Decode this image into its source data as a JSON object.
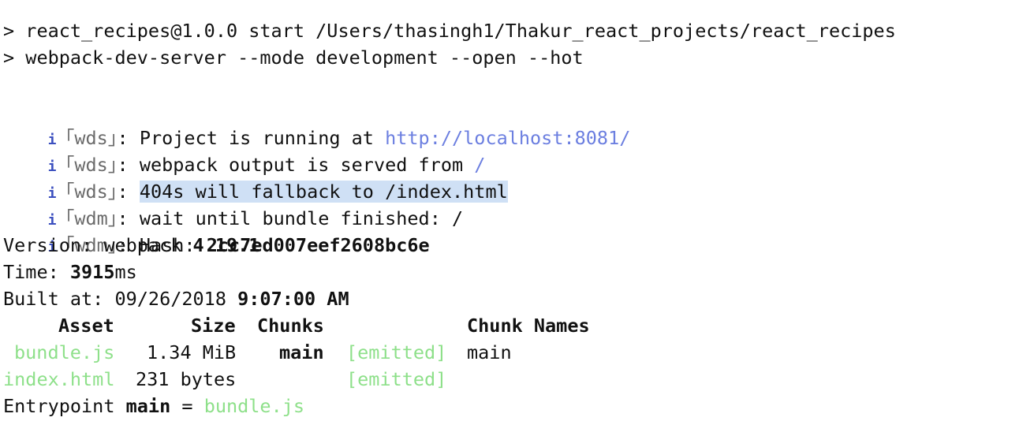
{
  "colors": {
    "background": "#ffffff",
    "text": "#111111",
    "info_icon": "#3b4fbf",
    "link": "#6c7fe0",
    "emitted_green": "#8ee08a",
    "selection": "#cfe0f5"
  },
  "header": {
    "line1": "> react_recipes@1.0.0 start /Users/thasingh1/Thakur_react_projects/react_recipes",
    "line2": "> webpack-dev-server --mode development --open --hot"
  },
  "info_icon_char": "i",
  "logs": [
    {
      "tag": "｢wds｣",
      "prefix": ": Project is running at ",
      "value": "http://localhost:8081/"
    },
    {
      "tag": "｢wds｣",
      "prefix": ": webpack output is served from ",
      "value": "/"
    },
    {
      "tag": "｢wds｣",
      "prefix": ": ",
      "value": "404s will fallback to /index.html"
    },
    {
      "tag": "｢wdm｣",
      "prefix": ": wait until bundle finished: /"
    },
    {
      "tag": "｢wdm｣",
      "prefix": ": Hash: ",
      "value": "2cc7ed007eef2608bc6e"
    }
  ],
  "version": {
    "label": "Version: webpack ",
    "value": "4.19.1"
  },
  "time": {
    "label": "Time: ",
    "value": "3915",
    "unit": "ms"
  },
  "built": {
    "label": "Built at: 09/26/2018 ",
    "value": "9:07:00 AM"
  },
  "table": {
    "headers": {
      "asset": "Asset",
      "size": "Size",
      "chunks": "Chunks",
      "chunk_names": "Chunk Names"
    },
    "rows": [
      {
        "asset": "bundle.js",
        "size": "1.34 MiB",
        "chunks": "main",
        "emitted": "[emitted]",
        "chunk_names": "main"
      },
      {
        "asset": "index.html",
        "size": "231 bytes",
        "chunks": "",
        "emitted": "[emitted]",
        "chunk_names": ""
      }
    ]
  },
  "entrypoint": {
    "label": "Entrypoint ",
    "name": "main",
    "eq": " = ",
    "file": "bundle.js"
  }
}
